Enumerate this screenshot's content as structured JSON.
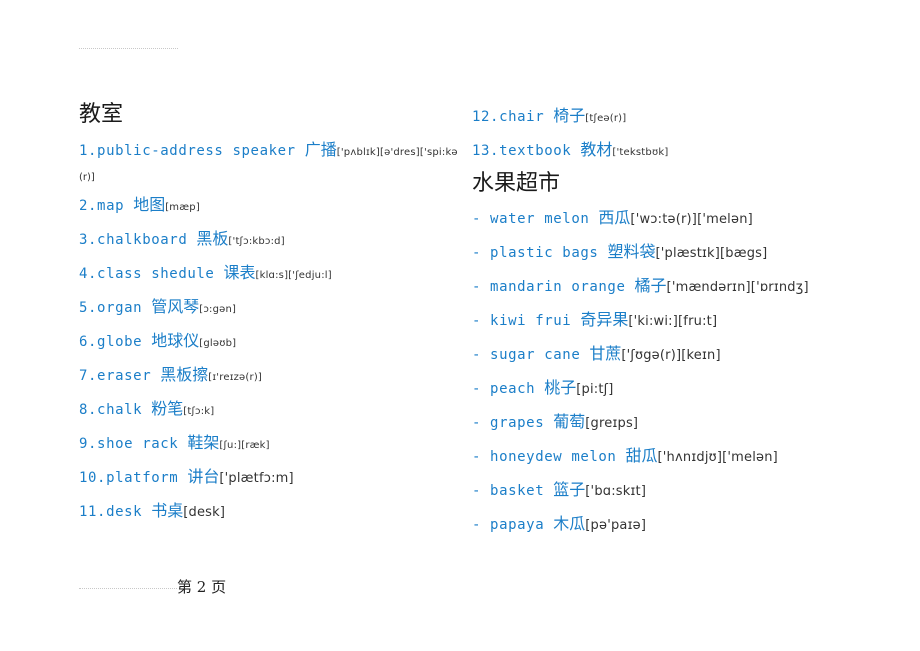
{
  "classroom": {
    "heading": "教室",
    "items": [
      {
        "en": "1.public-address speaker ",
        "zh": "广播",
        "ipa": "['pʌblɪk][ə'dres]['spi:kə",
        "ipa_cont": "(r)]"
      },
      {
        "en": "2.map ",
        "zh": "地图",
        "ipa": "[mæp]"
      },
      {
        "en": "3.chalkboard ",
        "zh": "黑板",
        "ipa": "['tʃɔ:kbɔ:d]"
      },
      {
        "en": "4.class shedule ",
        "zh": "课表",
        "ipa": "[klɑ:s]['ʃedju:l]"
      },
      {
        "en": "5.organ ",
        "zh": "管风琴",
        "ipa": "[ɔ:gən]"
      },
      {
        "en": "6.globe ",
        "zh": "地球仪",
        "ipa": "[gləʊb]"
      },
      {
        "en": "7.eraser ",
        "zh": "黑板擦",
        "ipa": "[ɪ'reɪzə(r)]"
      },
      {
        "en": "8.chalk ",
        "zh": "粉笔",
        "ipa": "[tʃɔ:k]"
      },
      {
        "en": "9.shoe rack ",
        "zh": "鞋架",
        "ipa": "[ʃu:][ræk]"
      },
      {
        "en": "10.platform ",
        "zh": "讲台",
        "ipa": "['plætfɔ:m]"
      },
      {
        "en": "11.desk ",
        "zh": "书桌",
        "ipa": "[desk]"
      },
      {
        "en": "12.chair ",
        "zh": "椅子",
        "ipa": "[tʃeə(r)]"
      },
      {
        "en": "13.textbook ",
        "zh": "教材",
        "ipa": "['tekstbʊk]"
      }
    ]
  },
  "supermarket": {
    "heading": "水果超市",
    "items": [
      {
        "en": "- water melon ",
        "zh": "西瓜",
        "ipa": "['wɔ:tə(r)]['melən]"
      },
      {
        "en": "- plastic bags ",
        "zh": "塑料袋",
        "ipa": "['plæstɪk][bægs]"
      },
      {
        "en": "- mandarin orange ",
        "zh": "橘子",
        "ipa": "['mændərɪn]['ɒrɪndʒ]"
      },
      {
        "en": "- kiwi frui ",
        "zh": "奇异果",
        "ipa": "['ki:wi:][fru:t]"
      },
      {
        "en": "- sugar cane ",
        "zh": "甘蔗",
        "ipa": "['ʃʊgə(r)][keɪn]"
      },
      {
        "en": "- peach ",
        "zh": "桃子",
        "ipa": "[pi:tʃ]"
      },
      {
        "en": "- grapes ",
        "zh": "葡萄",
        "ipa": "[greɪps]"
      },
      {
        "en": "- honeydew melon ",
        "zh": "甜瓜",
        "ipa": "['hʌnɪdjʊ]['melən]"
      },
      {
        "en": "- basket ",
        "zh": "篮子",
        "ipa": "['bɑ:skɪt]"
      },
      {
        "en": "- papaya ",
        "zh": "木瓜",
        "ipa": "[pə'paɪə]"
      }
    ]
  },
  "footer": {
    "page_label": "第 2 页"
  }
}
